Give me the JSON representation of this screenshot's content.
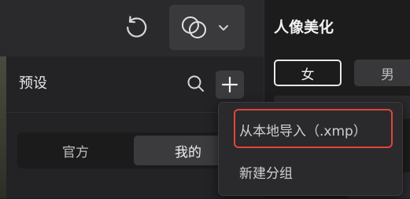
{
  "toolbar": {
    "undo_icon": "undo-icon",
    "blend_icon": "overlap-circles-icon",
    "dropdown_icon": "chevron-down-icon"
  },
  "presets": {
    "title": "预设",
    "search_icon": "search-icon",
    "add_icon": "plus-icon",
    "tabs": [
      {
        "label": "官方",
        "selected": false
      },
      {
        "label": "我的",
        "selected": true
      }
    ]
  },
  "add_menu": {
    "items": [
      {
        "label": "从本地导入（.xmp）",
        "highlighted": true
      },
      {
        "label": "新建分组",
        "highlighted": false
      }
    ],
    "highlight_color": "#e0453a"
  },
  "beautify": {
    "title": "人像美化",
    "gender_options": [
      {
        "label": "女",
        "selected": true
      },
      {
        "label": "男",
        "selected": false
      }
    ]
  }
}
